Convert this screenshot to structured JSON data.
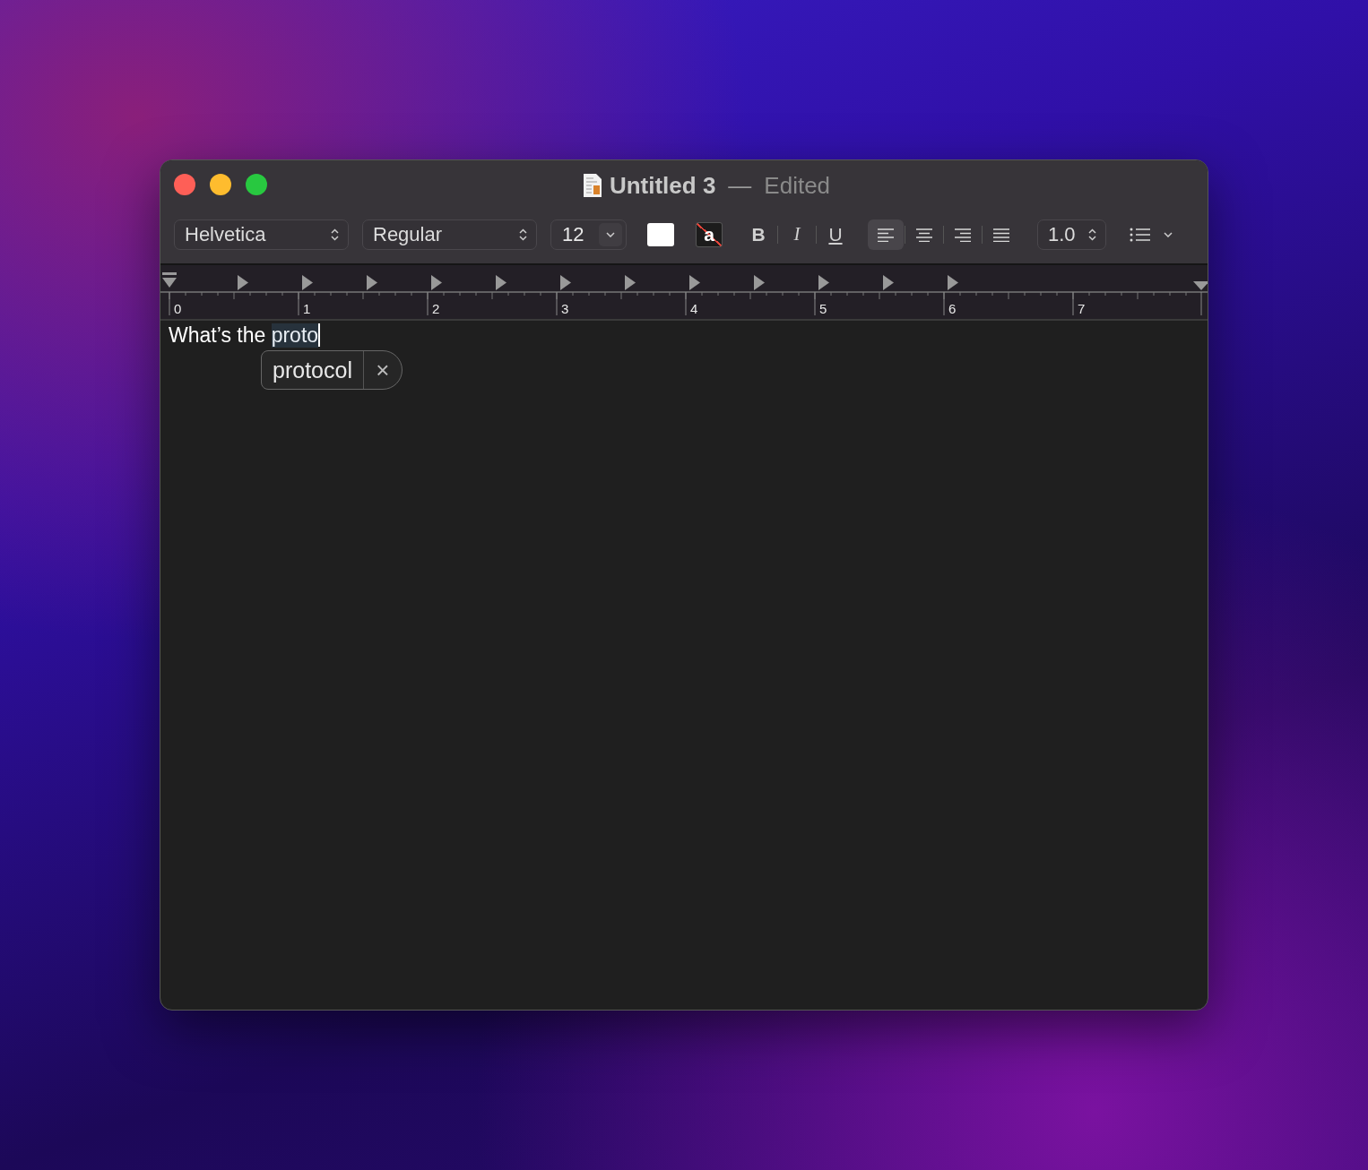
{
  "window": {
    "title": "Untitled 3",
    "separator": "—",
    "status": "Edited"
  },
  "toolbar": {
    "font_family": "Helvetica",
    "font_style": "Regular",
    "font_size": "12",
    "styles": [
      {
        "kind": "bold",
        "label": "B"
      },
      {
        "kind": "italic",
        "label": "I"
      },
      {
        "kind": "underline",
        "label": "U"
      }
    ],
    "alignment": [
      {
        "kind": "left",
        "selected": true
      },
      {
        "kind": "center",
        "selected": false
      },
      {
        "kind": "right",
        "selected": false
      },
      {
        "kind": "justify",
        "selected": false
      }
    ],
    "line_spacing": "1.0",
    "highlight_sample": "a"
  },
  "ruler": {
    "labels": [
      "0",
      "1",
      "2",
      "3",
      "4",
      "5",
      "6",
      "7"
    ]
  },
  "document": {
    "text": "What’s the ",
    "marked_text": "proto"
  },
  "suggestion": {
    "word": "protocol",
    "close": "×"
  }
}
